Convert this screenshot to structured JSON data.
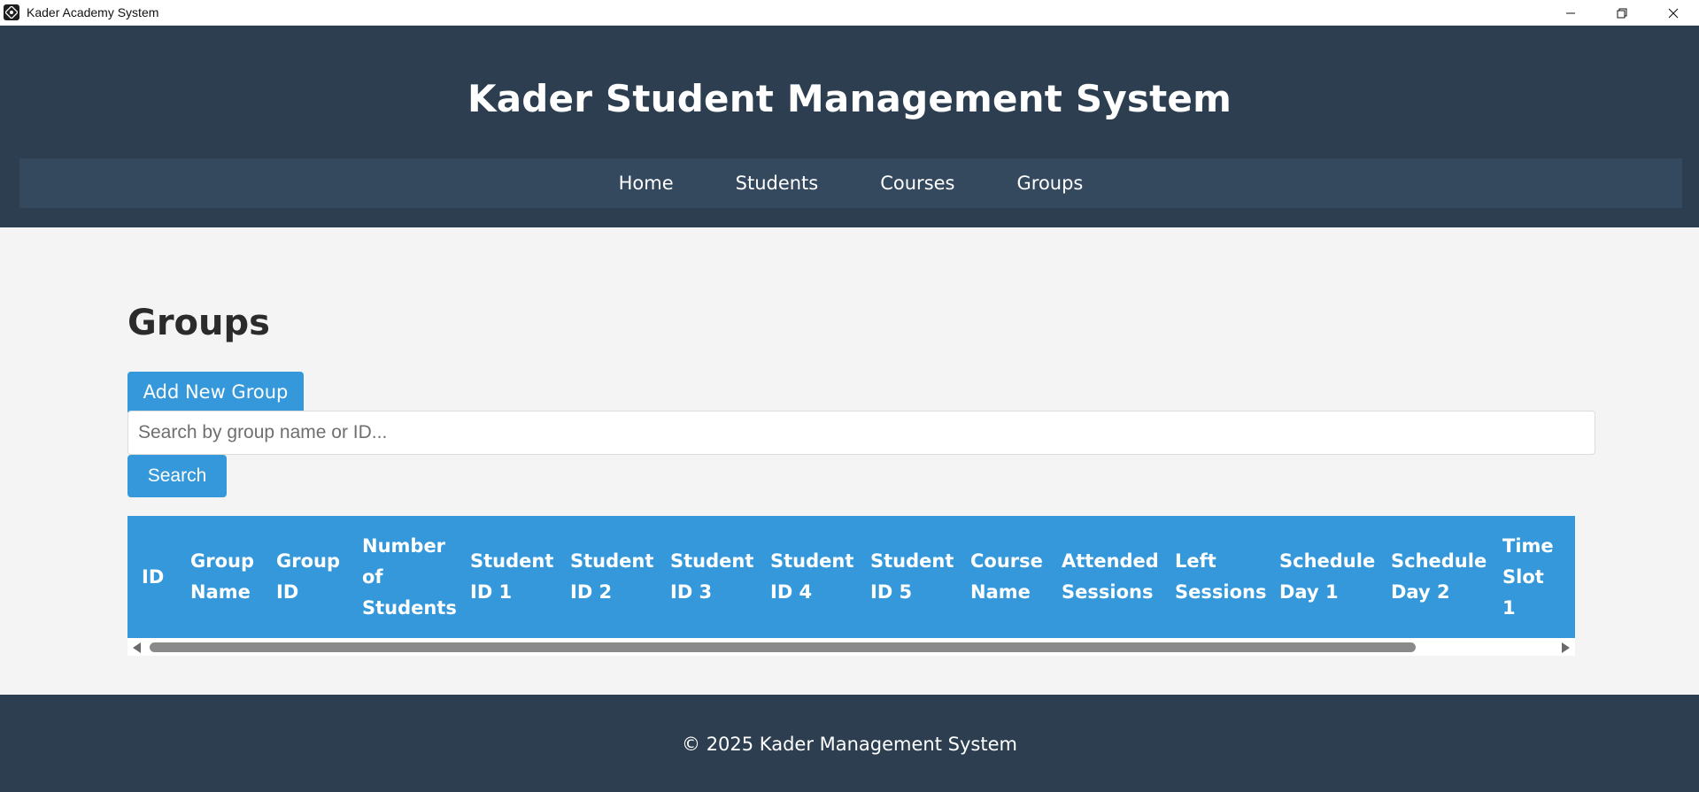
{
  "window": {
    "title": "Kader Academy System",
    "icon": "app-logo-icon",
    "controls": [
      "minimize-icon",
      "restore-icon",
      "close-icon"
    ]
  },
  "header": {
    "title": "Kader Student Management System",
    "nav": [
      "Home",
      "Students",
      "Courses",
      "Groups"
    ]
  },
  "main": {
    "page_title": "Groups",
    "add_button": "Add New Group",
    "search": {
      "placeholder": "Search by group name or ID...",
      "value": "",
      "button": "Search"
    },
    "table": {
      "columns": [
        "ID",
        "Group Name",
        "Group ID",
        "Number of Students",
        "Student ID 1",
        "Student ID 2",
        "Student ID 3",
        "Student ID 4",
        "Student ID 5",
        "Course Name",
        "Attended Sessions",
        "Left Sessions",
        "Schedule Day 1",
        "Schedule Day 2",
        "Time Slot 1"
      ],
      "rows": []
    }
  },
  "footer": {
    "text": "© 2025 Kader Management System"
  },
  "colors": {
    "header_bg": "#2c3e50",
    "nav_bg": "#34495e",
    "accent": "#3498db",
    "page_bg": "#f4f4f4"
  }
}
